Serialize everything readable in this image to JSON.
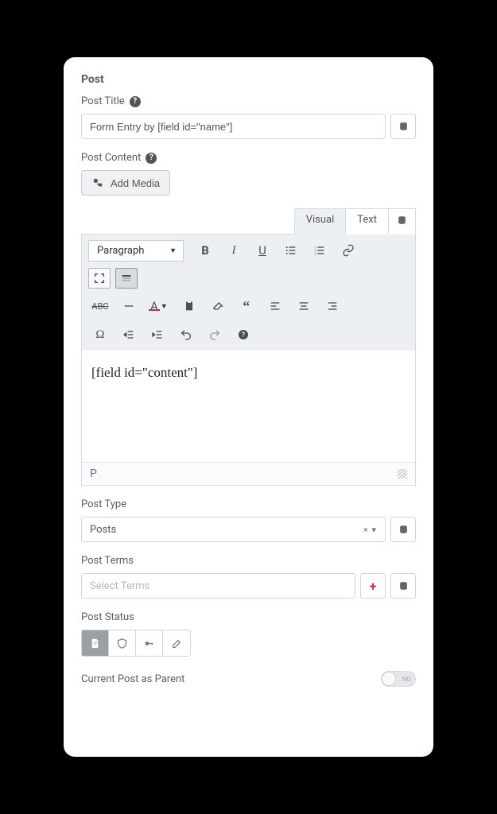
{
  "section_title": "Post",
  "post_title": {
    "label": "Post Title",
    "value": "Form Entry by [field id=\"name\"]"
  },
  "post_content": {
    "label": "Post Content",
    "add_media_label": "Add Media",
    "tabs": {
      "visual": "Visual",
      "text": "Text"
    },
    "format_selected": "Paragraph",
    "body": "[field id=\"content\"]",
    "status_path": "P"
  },
  "post_type": {
    "label": "Post Type",
    "value": "Posts",
    "clear_indicator": "× ▾"
  },
  "post_terms": {
    "label": "Post Terms",
    "placeholder": "Select Terms"
  },
  "post_status": {
    "label": "Post Status"
  },
  "parent_toggle": {
    "label": "Current Post as Parent",
    "state": "NO"
  }
}
